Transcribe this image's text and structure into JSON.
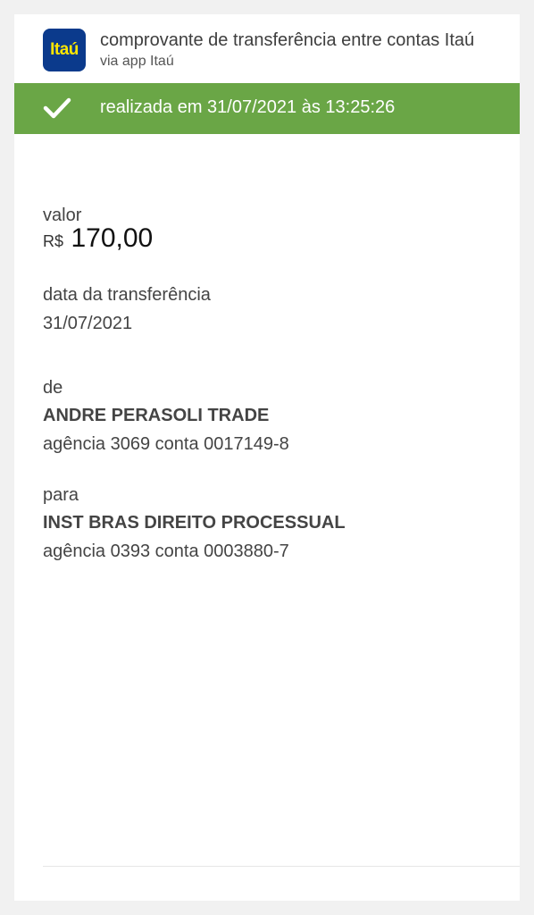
{
  "header": {
    "logo_text": "Itaú",
    "title": "comprovante de transferência entre contas Itaú",
    "subtitle": "via app Itaú"
  },
  "status": {
    "icon": "check-icon",
    "text": "realizada em 31/07/2021 às 13:25:26",
    "color": "#6aa646"
  },
  "value": {
    "label": "valor",
    "currency": "R$",
    "amount": "170,00"
  },
  "transfer_date": {
    "label": "data da transferência",
    "value": "31/07/2021"
  },
  "from": {
    "label": "de",
    "name": "ANDRE PERASOLI TRADE",
    "account": "agência 3069 conta 0017149-8"
  },
  "to": {
    "label": "para",
    "name": "INST BRAS DIREITO PROCESSUAL",
    "account": "agência 0393 conta 0003880-7"
  },
  "colors": {
    "brand_blue": "#0b3a8c",
    "brand_yellow": "#ffe600",
    "success_green": "#6aa646"
  }
}
